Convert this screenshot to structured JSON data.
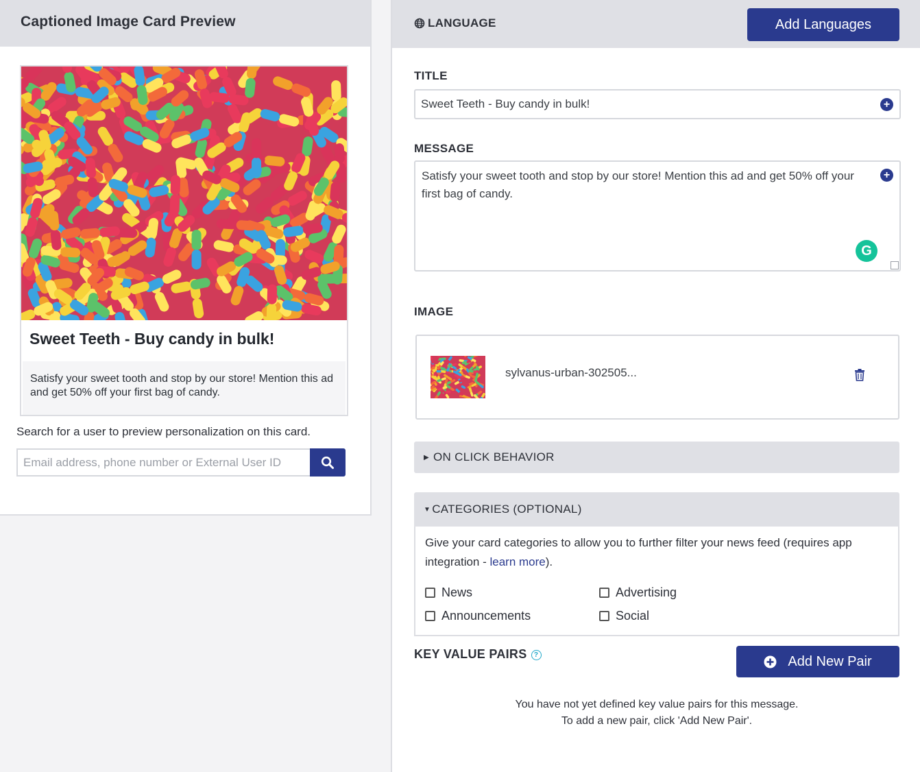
{
  "preview": {
    "header_title": "Captioned Image Card Preview",
    "card_title": "Sweet Teeth - Buy candy in bulk!",
    "card_body": "Satisfy your sweet tooth and stop by our store! Mention this ad and get 50% off your first bag of candy.",
    "search_label": "Search for a user to preview personalization on this card.",
    "search_placeholder": "Email address, phone number or External User ID"
  },
  "language": {
    "label": "LANGUAGE",
    "add_button": "Add Languages"
  },
  "title_field": {
    "label": "TITLE",
    "value": "Sweet Teeth - Buy candy in bulk!"
  },
  "message_field": {
    "label": "MESSAGE",
    "value": "Satisfy your sweet tooth and stop by our store! Mention this ad and get 50% off your first bag of candy."
  },
  "image_field": {
    "label": "IMAGE",
    "file_name": "sylvanus-urban-302505..."
  },
  "on_click": {
    "label": "ON CLICK BEHAVIOR"
  },
  "categories": {
    "label": "CATEGORIES (OPTIONAL)",
    "description": "Give your card categories to allow you to further filter your news feed (requires app integration - ",
    "link_text": "learn more",
    "description_end": ").",
    "options": [
      "News",
      "Advertising",
      "Announcements",
      "Social"
    ]
  },
  "key_value": {
    "label": "KEY VALUE PAIRS",
    "add_button": "Add New Pair",
    "empty_line1": "You have not yet defined key value pairs for this message.",
    "empty_line2": "To add a new pair, click 'Add New Pair'."
  },
  "colors": {
    "primary": "#2a3a8e",
    "grammarly": "#15c39a",
    "header_bg": "#dfe0e5"
  }
}
